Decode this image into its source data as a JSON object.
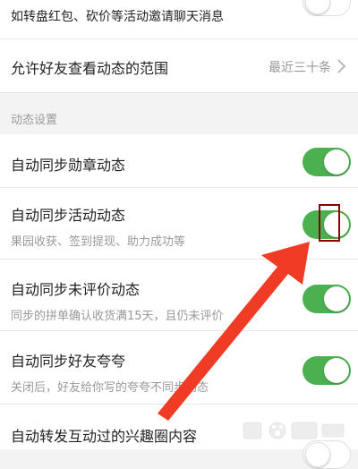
{
  "rows": {
    "redpacket_invite": {
      "title": "如转盘红包、砍价等活动邀请聊天消息",
      "toggle": "off"
    },
    "friend_scope": {
      "title": "允许好友查看动态的范围",
      "value": "最近三十条"
    }
  },
  "section": {
    "label": "动态设置"
  },
  "settings": [
    {
      "title": "自动同步勋章动态",
      "subtitle": "",
      "toggle": "on"
    },
    {
      "title": "自动同步活动动态",
      "subtitle": "果园收获、签到提现、助力成功等",
      "toggle": "on"
    },
    {
      "title": "自动同步未评价动态",
      "subtitle": "同步的拼单确认收货满15天，且仍未评价",
      "toggle": "on"
    },
    {
      "title": "自动同步好友夸夸",
      "subtitle": "关闭后，好友给你写的夸夸不同步动态",
      "toggle": "on"
    },
    {
      "title": "自动转发互动过的兴趣圈内容",
      "subtitle": "",
      "toggle": "off"
    }
  ],
  "colors": {
    "toggle_on": "#4caf50",
    "arrow": "#f03c24",
    "highlight": "#8b0000"
  },
  "icons": {
    "chevron": "chevron-right-icon",
    "watermark": "baidu-logo-icon"
  }
}
